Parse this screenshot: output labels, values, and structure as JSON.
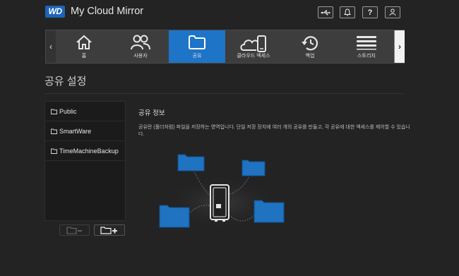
{
  "header": {
    "logo_text": "WD",
    "app_title": "My Cloud Mirror",
    "buttons": [
      {
        "name": "usb-icon",
        "glyph": "⇌"
      },
      {
        "name": "bell-icon",
        "glyph": ""
      },
      {
        "name": "help-icon",
        "glyph": "?"
      },
      {
        "name": "user-icon",
        "glyph": ""
      }
    ]
  },
  "nav": {
    "items": [
      {
        "label": "홈",
        "icon": "home-icon",
        "active": false
      },
      {
        "label": "사용자",
        "icon": "users-icon",
        "active": false
      },
      {
        "label": "공유",
        "icon": "folder-icon",
        "active": true
      },
      {
        "label": "클라우드 액세스",
        "icon": "cloud-access-icon",
        "active": false
      },
      {
        "label": "백업",
        "icon": "backup-icon",
        "active": false
      },
      {
        "label": "스토리지",
        "icon": "storage-icon",
        "active": false
      }
    ],
    "left_arrow": "‹",
    "right_arrow": "›"
  },
  "page_title": "공유 설정",
  "shares": [
    {
      "label": "Public"
    },
    {
      "label": "SmartWare"
    },
    {
      "label": "TimeMachineBackup"
    }
  ],
  "info": {
    "heading": "공유 정보",
    "description": "공유란 (폴더처럼) 파일을 저장하는 영역입니다. 단일 저장 장치에 여러 개의 공유를 만들고, 각 공유에 대한 액세스를 제어할 수 있습니다."
  },
  "colors": {
    "accent": "#1e74c6",
    "folder_blue": "#1f73c0",
    "background": "#232323"
  }
}
